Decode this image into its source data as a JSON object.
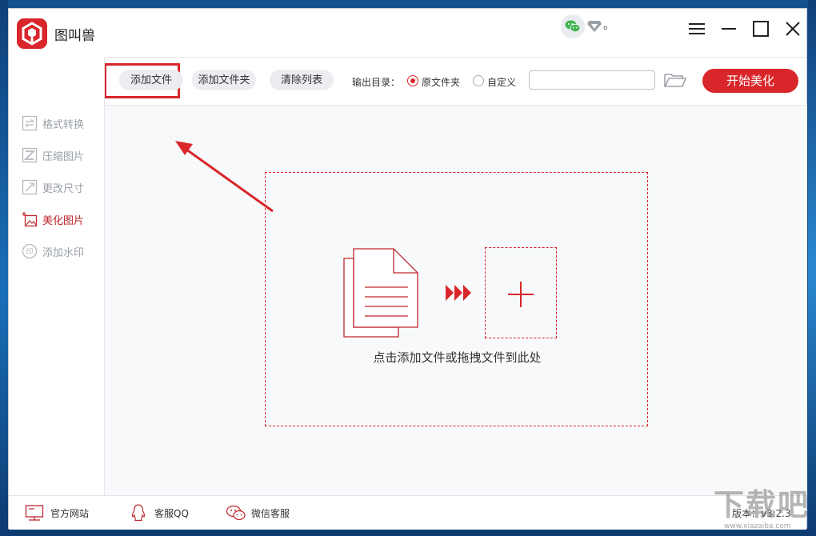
{
  "app": {
    "title": "图叫兽",
    "title_dot": "。"
  },
  "toolbar": {
    "add_file": "添加文件",
    "add_folder": "添加文件夹",
    "clear_list": "清除列表",
    "output_label": "输出目录：",
    "option_original": "原文件夹",
    "option_custom": "自定义",
    "selected_option": "原文件夹",
    "path_value": "",
    "start": "开始美化"
  },
  "sidebar": {
    "items": [
      {
        "label": "格式转换",
        "icon": "convert-icon",
        "active": false
      },
      {
        "label": "压缩图片",
        "icon": "compress-icon",
        "active": false
      },
      {
        "label": "更改尺寸",
        "icon": "resize-icon",
        "active": false
      },
      {
        "label": "美化图片",
        "icon": "beautify-icon",
        "active": true
      },
      {
        "label": "添加水印",
        "icon": "watermark-icon",
        "active": false
      }
    ]
  },
  "dropzone": {
    "text": "点击添加文件或拖拽文件到此处"
  },
  "footer": {
    "website": "官方网站",
    "qq": "客服QQ",
    "wechat": "微信客服",
    "version": "版本：v3.2.3"
  },
  "watermark": {
    "text": "下载吧",
    "site": "www.xiazaiba.com"
  },
  "colors": {
    "accent": "#d9262a",
    "active_text": "#c0272d",
    "inactive_text": "#9aa0a6"
  }
}
